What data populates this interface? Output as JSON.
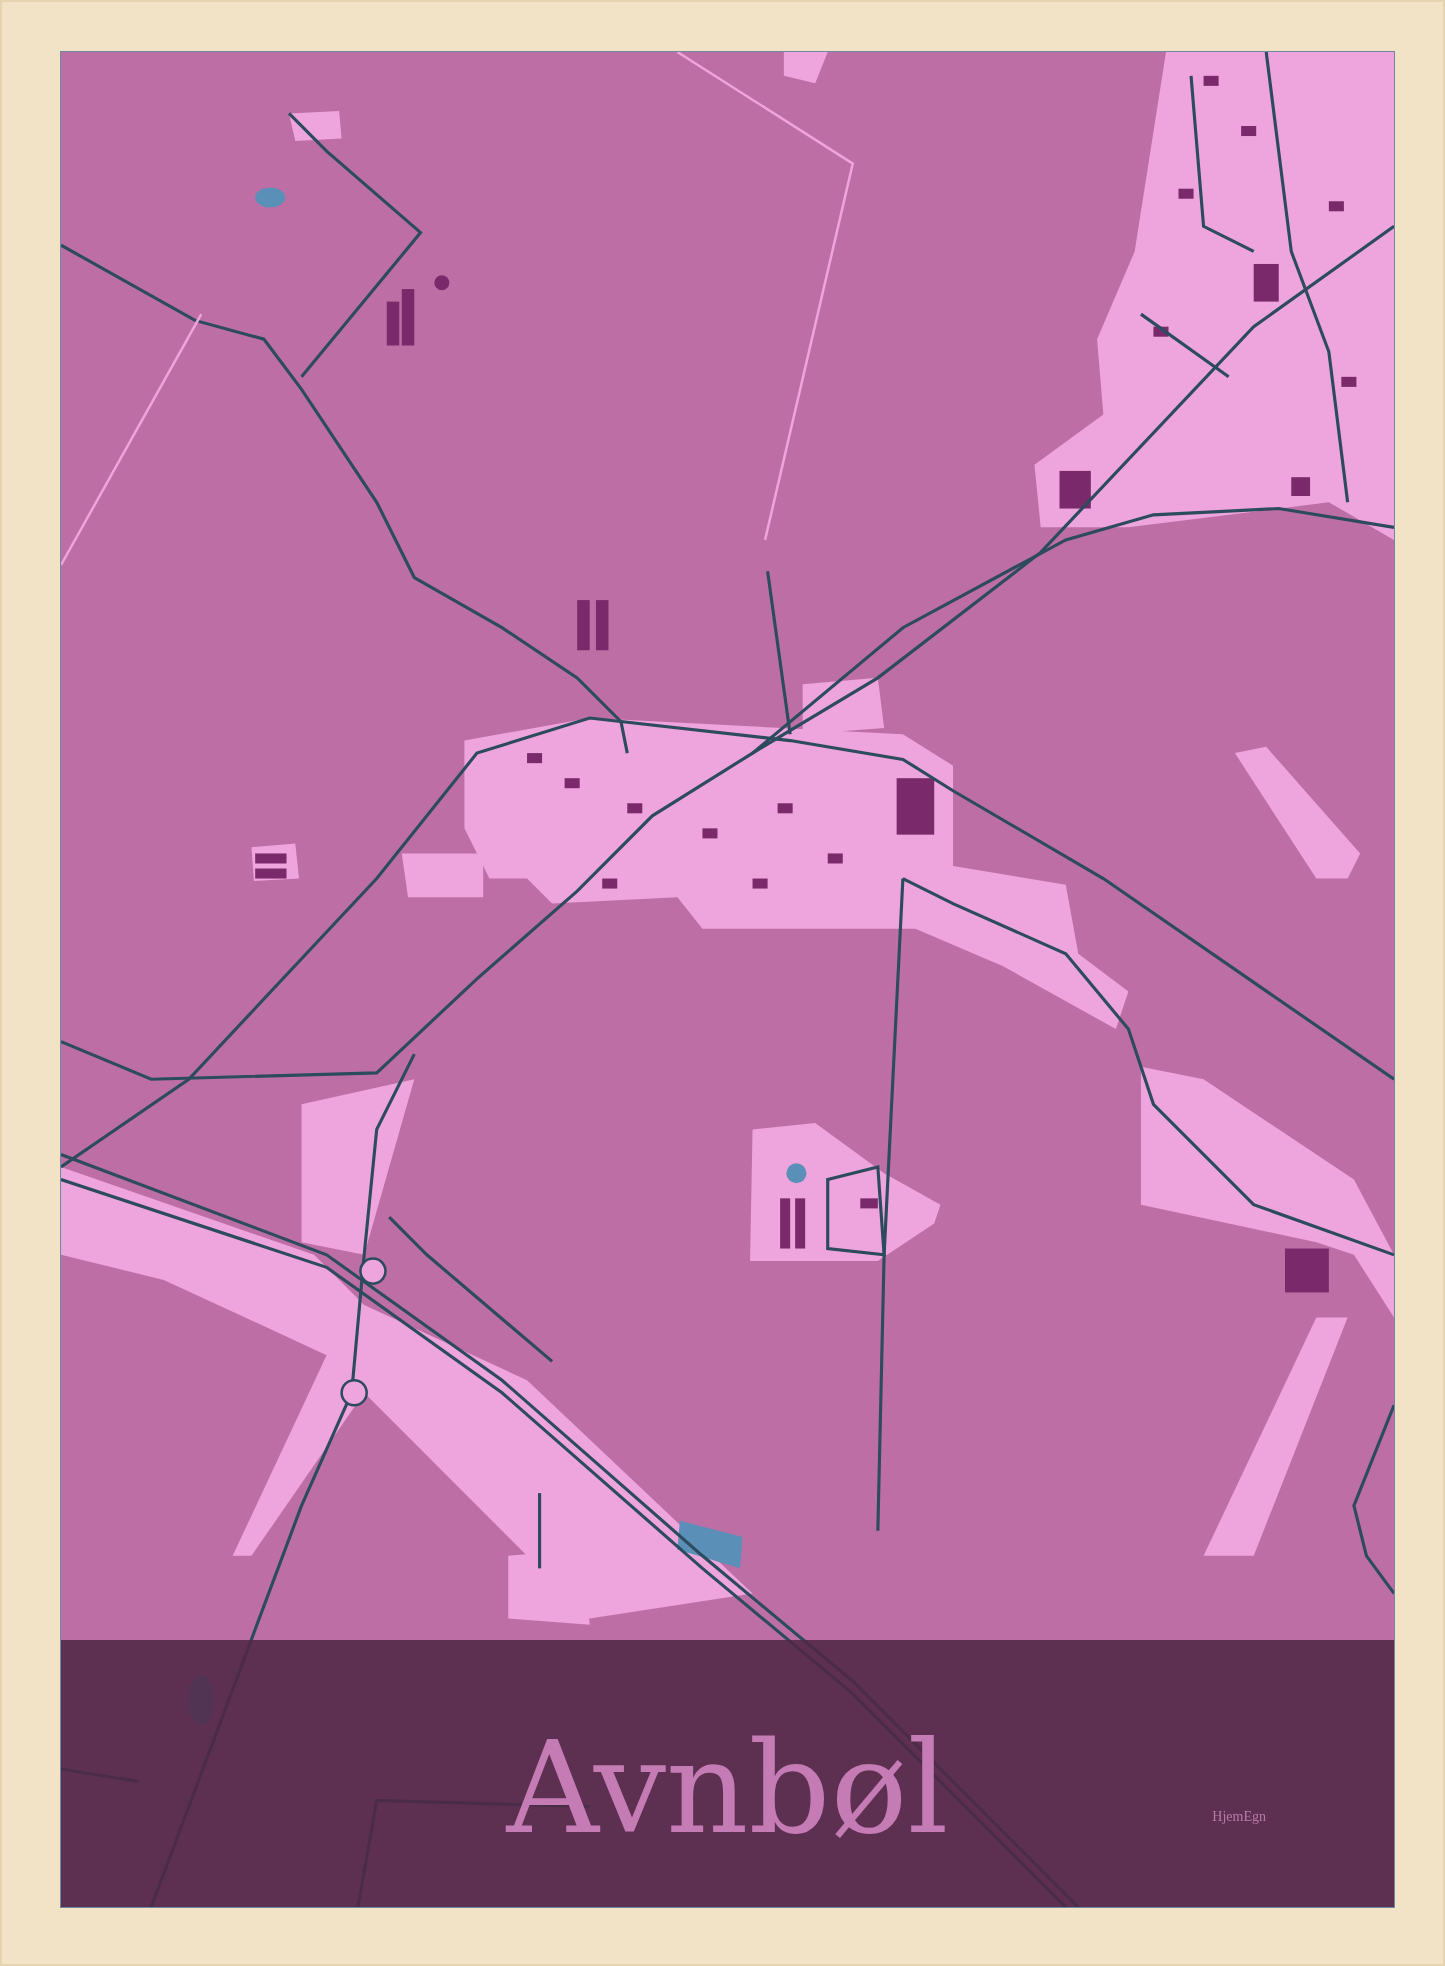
{
  "title": "Avnbøl",
  "brand": "HjemEgn"
}
